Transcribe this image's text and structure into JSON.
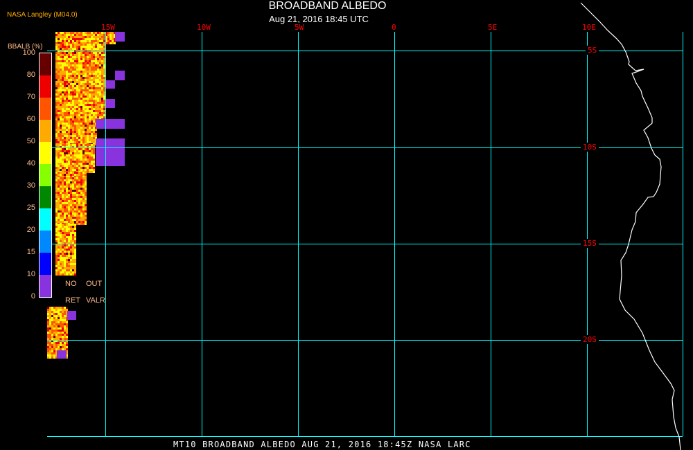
{
  "header": {
    "title": "BROADBAND ALBEDO",
    "subtitle": "Aug 21, 2016 18:45 UTC",
    "source": "NASA Langley (M04.0)"
  },
  "footer": "MT10   BROADBAND ALBEDO    AUG 21, 2016 18:45Z    NASA LARC",
  "map": {
    "lon_labels": [
      "15W",
      "10W",
      "5W",
      "0",
      "5E",
      "10E"
    ],
    "lat_labels": [
      "5S",
      "10S",
      "15S",
      "20S"
    ],
    "grid_color": "#00ffff",
    "label_color": "#ff0000",
    "coast_color": "#ffffff"
  },
  "colorbar": {
    "title": "BBALB (%)",
    "tick_labels": [
      "100",
      "80",
      "70",
      "60",
      "50",
      "40",
      "30",
      "25",
      "20",
      "15",
      "10",
      "0"
    ],
    "colors": [
      "#660000",
      "#ee0000",
      "#ff5500",
      "#ffaa00",
      "#ffff00",
      "#88ff00",
      "#008800",
      "#00ffff",
      "#0088ff",
      "#0000ff",
      "#8833dd"
    ],
    "no_ret": [
      "NO",
      "RET"
    ],
    "out_valr": [
      "OUT",
      "VALR"
    ]
  }
}
